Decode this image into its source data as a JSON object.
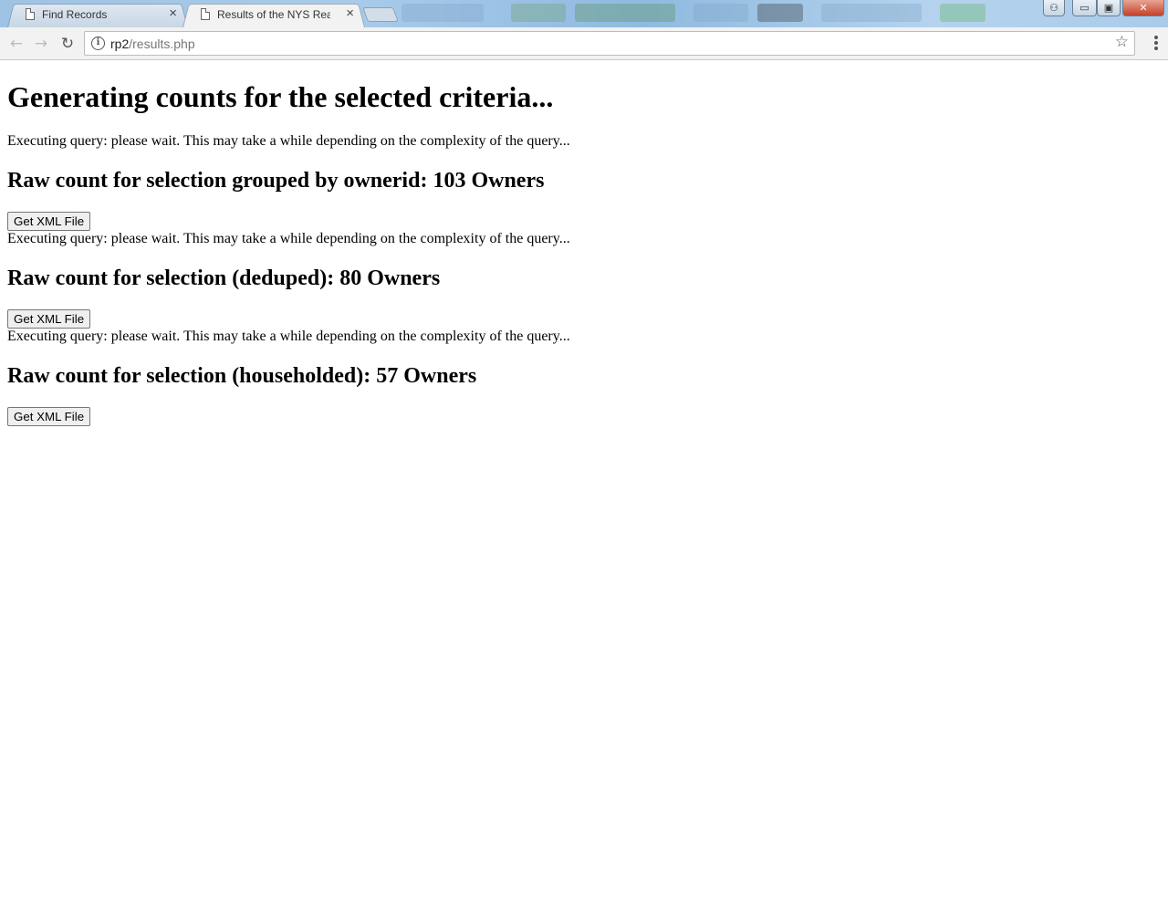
{
  "browser": {
    "tabs": [
      {
        "title": "Find Records",
        "close": "×",
        "active": false
      },
      {
        "title": "Results of the NYS Real F",
        "close": "×",
        "active": true
      }
    ],
    "address": {
      "host": "rp2",
      "path": "/results.php"
    },
    "icons": {
      "back": "back-arrow-icon",
      "forward": "forward-arrow-icon",
      "reload": "reload-icon",
      "info": "info-icon",
      "star": "bookmark-star-icon",
      "menu": "kebab-menu-icon"
    },
    "glyphs": {
      "back": "←",
      "forward": "→",
      "reload": "↻",
      "info": "i",
      "star": "☆",
      "minimize": "▭",
      "maximize": "▣",
      "close": "✕",
      "profile": "⚇"
    }
  },
  "page": {
    "heading": "Generating counts for the selected criteria...",
    "sections": [
      {
        "status": "Executing query: please wait. This may take a while depending on the complexity of the query...",
        "result": "Raw count for selection grouped by ownerid: 103 Owners",
        "button": "Get XML File"
      },
      {
        "status": "Executing query: please wait. This may take a while depending on the complexity of the query...",
        "result": "Raw count for selection (deduped): 80 Owners",
        "button": "Get XML File"
      },
      {
        "status": "Executing query: please wait. This may take a while depending on the complexity of the query...",
        "result": "Raw count for selection (householded): 57 Owners",
        "button": "Get XML File"
      }
    ]
  }
}
